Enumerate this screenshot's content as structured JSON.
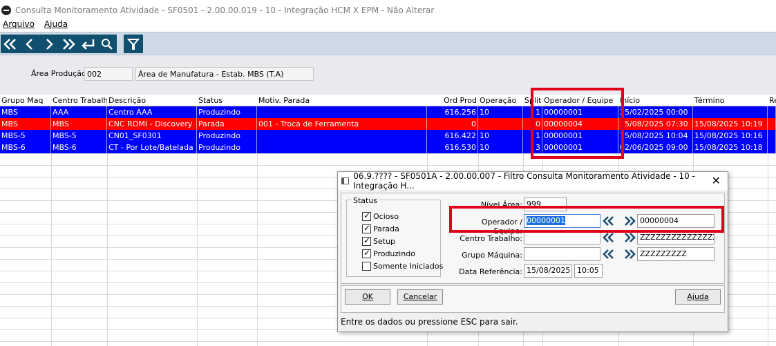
{
  "window": {
    "title": "Consulta Monitoramento Atividade - SF0501 - 2.00.00.019 - 10 - Integração HCM X EPM - Não Alterar"
  },
  "menu": [
    "Arquivo",
    "Ajuda"
  ],
  "toolbar": {
    "buttons": [
      "first-icon",
      "previous-icon",
      "next-icon",
      "last-icon",
      "return-icon",
      "search-icon",
      "filter-icon"
    ]
  },
  "area": {
    "label": "Área Produção:",
    "code": "002",
    "description": "Área de Manufatura - Estab. MBS (T.A)"
  },
  "table": {
    "columns": [
      "Grupo Maq",
      "Centro Trabalho",
      "Descrição",
      "Status",
      "Motiv. Parada",
      "Ord Prod",
      "Operação",
      "Split",
      "Operador / Equipe",
      "Início",
      "Término",
      "Re"
    ],
    "rows": [
      {
        "color": "#0000ff",
        "cells": [
          "MBS",
          "AAA",
          "Centro AAA",
          "Produzindo",
          "",
          "616.256",
          "10",
          "1",
          "00000001",
          "25/02/2025 00:00",
          "",
          ""
        ]
      },
      {
        "color": "#ff0000",
        "cells": [
          "MBS",
          "MBS",
          "CNC ROMI - Discovery",
          "Parada",
          "001      - Troca de Ferramenta",
          "0",
          "",
          "0",
          "00000004",
          "15/08/2025 07:30",
          "15/08/2025 10:19",
          ""
        ]
      },
      {
        "color": "#0000ff",
        "cells": [
          "MBS-5",
          "MBS-5",
          "CN01_SF0301",
          "Produzindo",
          "",
          "616.422",
          "10",
          "1",
          "00000001",
          "15/08/2025 10:04",
          "15/08/2025 10:16",
          ""
        ]
      },
      {
        "color": "#0000ff",
        "cells": [
          "MBS-6",
          "MBS-6",
          "CT - Por Lote/Batelada",
          "Produzindo",
          "",
          "616.530",
          "10",
          "3",
          "00000001",
          "02/06/2025 09:00",
          "15/08/2025 10:18",
          ""
        ]
      }
    ]
  },
  "dialog": {
    "title": "06.9.???? - SF0501A - 2.00.00.007 - Filtro Consulta Monitoramento Atividade - 10 - Integração H...",
    "status_legend": "Status",
    "checks": [
      {
        "label": "Ocioso",
        "checked": true
      },
      {
        "label": "Parada",
        "checked": true
      },
      {
        "label": "Setup",
        "checked": true
      },
      {
        "label": "Produzindo",
        "checked": true
      },
      {
        "label": "Somente Iniciados",
        "checked": false
      }
    ],
    "nivel_area_label": "Nível Área:",
    "nivel_area_value": "999",
    "operador_label": "Operador / Equipe:",
    "operador_from": "00000001",
    "operador_to": "00000004",
    "centro_label": "Centro Trabalho:",
    "centro_from": "",
    "centro_to": "ZZZZZZZZZZZZZZZZ",
    "grupo_label": "Grupo Máquina:",
    "grupo_from": "",
    "grupo_to": "ZZZZZZZZZ",
    "data_label": "Data Referência:",
    "data_value": "15/08/2025",
    "hora_value": "10:05",
    "ok_label": "OK",
    "cancel_label": "Cancelar",
    "help_label": "Ajuda",
    "status_text": "Entre os dados ou pressione ESC para sair."
  },
  "colors": {
    "toolbar": "#104f6e",
    "highlight": "#e0001b",
    "row_blue": "#0000ff",
    "row_red": "#ff0000"
  }
}
